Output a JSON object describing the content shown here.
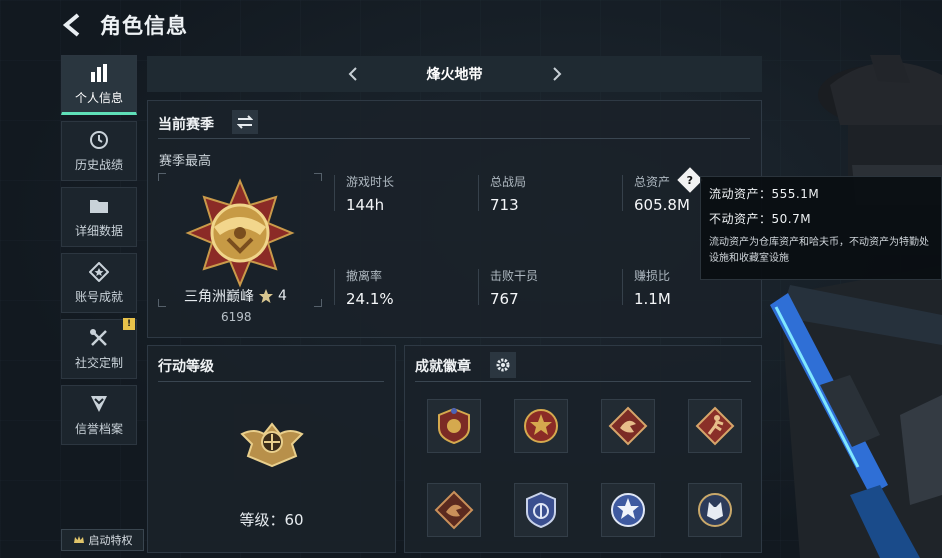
{
  "header": {
    "title": "角色信息"
  },
  "sidebar": {
    "items": [
      {
        "label": "个人信息",
        "icon": "bar-chart-icon",
        "active": true
      },
      {
        "label": "历史战绩",
        "icon": "history-clock-icon"
      },
      {
        "label": "详细数据",
        "icon": "folder-icon"
      },
      {
        "label": "账号成就",
        "icon": "diamond-star-icon"
      },
      {
        "label": "社交定制",
        "icon": "tools-icon",
        "badge": "!"
      },
      {
        "label": "信誉档案",
        "icon": "shield-chevron-icon"
      }
    ],
    "privilege_label": "启动特权"
  },
  "mode": {
    "title": "烽火地带"
  },
  "season": {
    "title": "当前赛季",
    "subtitle": "赛季最高",
    "rank_name": "三角洲巅峰",
    "rank_stars": "4",
    "rank_points": "6198",
    "stats": [
      {
        "label": "游戏时长",
        "value": "144h"
      },
      {
        "label": "总战局",
        "value": "713"
      },
      {
        "label": "总资产",
        "value": "605.8M"
      },
      {
        "label": "撤离率",
        "value": "24.1%"
      },
      {
        "label": "击败干员",
        "value": "767"
      },
      {
        "label": "赚损比",
        "value": "1.1M"
      }
    ]
  },
  "tooltip": {
    "liquid": "流动资产：555.1M",
    "fixed": "不动资产：50.7M",
    "note_line1": "流动资产为仓库资产和哈夫币，不动资产为特勤处",
    "note_line2": "设施和收藏室设施"
  },
  "level": {
    "title": "行动等级",
    "text": "等级：60"
  },
  "achievements": {
    "title": "成就徽章",
    "badges": [
      "eagle-shield-badge",
      "star-shield-badge",
      "dragon-diamond-badge",
      "runner-diamond-badge",
      "dragon-bronze-badge",
      "shield-blue-badge",
      "star-circle-badge",
      "wolf-circle-badge"
    ]
  },
  "colors": {
    "accent": "#5fe0b8",
    "gold": "#d8b15a",
    "background": "#141b22"
  }
}
